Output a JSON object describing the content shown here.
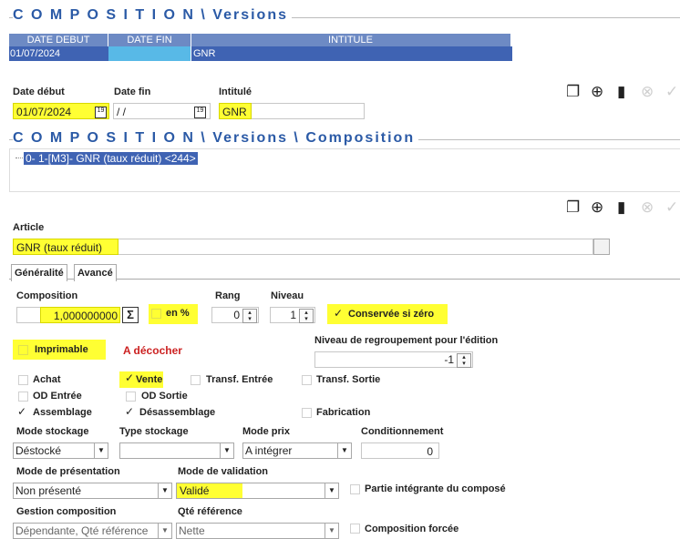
{
  "versions": {
    "title": "C O M P O S I T I O N \\ Versions",
    "columns": [
      "DATE DEBUT",
      "DATE FIN",
      "INTITULE"
    ],
    "rows": [
      {
        "date_debut": "01/07/2024",
        "date_fin": "",
        "intitule": "GNR"
      }
    ]
  },
  "version_form": {
    "date_debut_label": "Date début",
    "date_fin_label": "Date fin",
    "intitule_label": "Intitulé",
    "date_debut_value": "01/07/2024",
    "date_fin_value": " / /",
    "intitule_value": "GNR",
    "calendar_glyph": "19"
  },
  "composition": {
    "title": "C O M P O S I T I O N \\ Versions \\ Composition",
    "tree_item": "0- 1-[M3]- GNR  (taux réduit) <244>"
  },
  "toolbar_icons": [
    "copy-icon",
    "add-icon",
    "delete-icon",
    "cancel-icon",
    "validate-icon"
  ],
  "article": {
    "label": "Article",
    "value": "GNR  (taux réduit)"
  },
  "tabs": {
    "generalite": "Généralité",
    "avance": "Avancé"
  },
  "fields": {
    "composition_label": "Composition",
    "composition_value": "1,000000000",
    "sigma": "Σ",
    "en_pct": "en %",
    "rang_label": "Rang",
    "rang_value": "0",
    "niveau_label": "Niveau",
    "niveau_value": "1",
    "conservee": "Conservée si zéro",
    "imprimable": "Imprimable",
    "a_decocher": "A décocher",
    "niveau_regroupement_label": "Niveau de regroupement pour l'édition",
    "niveau_regroupement_value": "-1",
    "achat": "Achat",
    "vente": "Vente",
    "transf_entree": "Transf. Entrée",
    "transf_sortie": "Transf. Sortie",
    "od_entree": "OD Entrée",
    "od_sortie": "OD Sortie",
    "assemblage": "Assemblage",
    "desassemblage": "Désassemblage",
    "fabrication": "Fabrication",
    "mode_stockage_label": "Mode stockage",
    "mode_stockage_value": "Déstocké",
    "type_stockage_label": "Type stockage",
    "type_stockage_value": "",
    "mode_prix_label": "Mode prix",
    "mode_prix_value": "A intégrer",
    "conditionnement_label": "Conditionnement",
    "conditionnement_value": "0",
    "mode_presentation_label": "Mode de présentation",
    "mode_presentation_value": "Non présenté",
    "mode_validation_label": "Mode de validation",
    "mode_validation_value": "Validé",
    "partie_integrante": "Partie intégrante du composé",
    "gestion_composition_label": "Gestion composition",
    "gestion_composition_value": "Dépendante, Qté référence",
    "qte_reference_label": "Qté référence",
    "qte_reference_value": "Nette",
    "composition_forcee": "Composition forcée",
    "check_glyph": "✓"
  },
  "colors": {
    "title": "#2b5aa6",
    "header": "#6d8ac4",
    "highlight": "#ffff33",
    "selected_row": "#3f63b3",
    "warning": "#cc2222"
  }
}
